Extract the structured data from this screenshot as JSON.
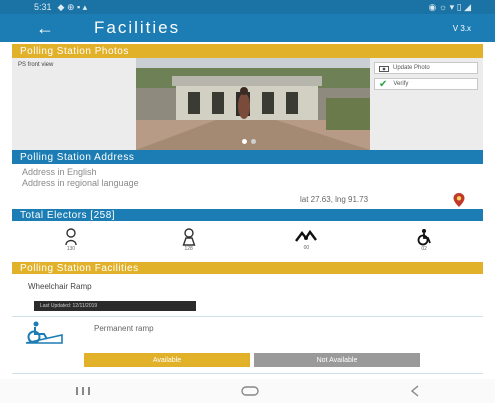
{
  "status_bar": {
    "time": "5:31",
    "indicators": "◆ ⊕ ▪ ▴",
    "right": "◉ ☼ ▾ ▯ ◢"
  },
  "header": {
    "back_icon": "arrow-left-icon",
    "title": "Facilities",
    "version": "V 3.x"
  },
  "photos": {
    "section_title": "Polling Station Photos",
    "label": "PS front view",
    "update_label": "Update Photo",
    "verify_label": "Verify"
  },
  "address": {
    "section_title": "Polling Station Address",
    "line1": "Address in English",
    "line2": "Address in regional language",
    "coordinates": "lat 27.63, lng 91.73"
  },
  "voters": {
    "section_title": "Total Electors [258]",
    "items": [
      {
        "icon": "male-voter-icon",
        "count": "130"
      },
      {
        "icon": "female-voter-icon",
        "count": "128"
      },
      {
        "icon": "third-gender-icon",
        "count": "00"
      },
      {
        "icon": "pwd-voter-icon",
        "count": "02"
      }
    ]
  },
  "facilities": {
    "section_title": "Polling Station Facilities",
    "ramp_title": "Wheelchair Ramp",
    "ramp_tag": "Last Updated: 12/11/2019",
    "item_label": "Permanent ramp",
    "available_label": "Available",
    "not_available_label": "Not Available"
  },
  "colors": {
    "primary": "#1c7db4",
    "accent": "#e2b12a"
  }
}
